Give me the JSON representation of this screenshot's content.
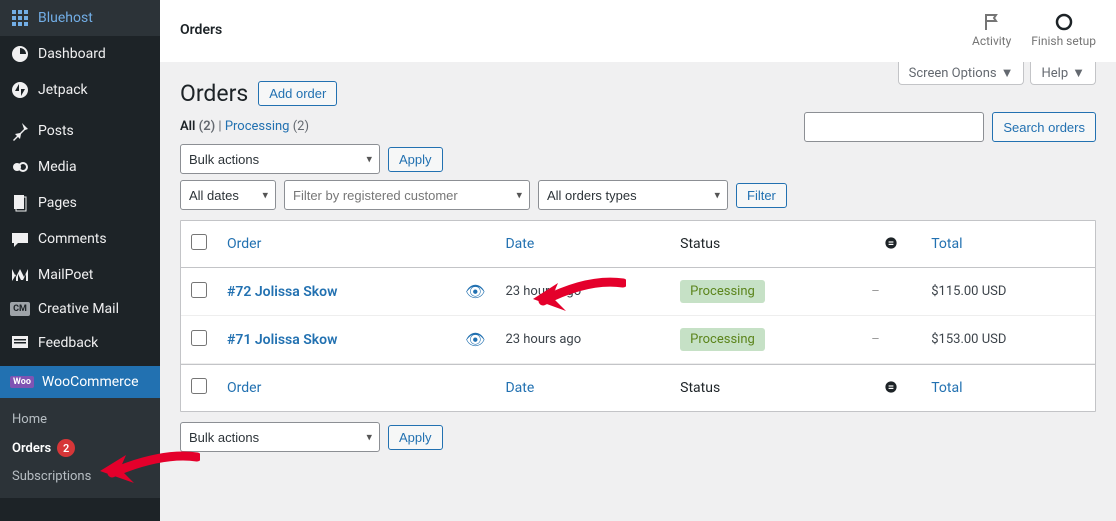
{
  "sidebar": {
    "items": [
      {
        "label": "Bluehost"
      },
      {
        "label": "Dashboard"
      },
      {
        "label": "Jetpack"
      },
      {
        "label": "Posts"
      },
      {
        "label": "Media"
      },
      {
        "label": "Pages"
      },
      {
        "label": "Comments"
      },
      {
        "label": "MailPoet"
      },
      {
        "label": "Creative Mail"
      },
      {
        "label": "Feedback"
      },
      {
        "label": "WooCommerce"
      }
    ],
    "submenu": [
      {
        "label": "Home"
      },
      {
        "label": "Orders",
        "badge": "2"
      },
      {
        "label": "Subscriptions"
      }
    ]
  },
  "topbar": {
    "title": "Orders",
    "activity": "Activity",
    "finish": "Finish setup"
  },
  "screen_options": "Screen Options",
  "help": "Help",
  "heading": "Orders",
  "add_order": "Add order",
  "subsub": {
    "all": "All",
    "all_count": "(2)",
    "sep": " | ",
    "processing": "Processing",
    "processing_count": "(2)"
  },
  "search_btn": "Search orders",
  "bulk_actions": "Bulk actions",
  "apply": "Apply",
  "all_dates": "All dates",
  "filter_customer": "Filter by registered customer",
  "all_orders_types": "All orders types",
  "filter": "Filter",
  "cols": {
    "order": "Order",
    "date": "Date",
    "status": "Status",
    "total": "Total"
  },
  "rows": [
    {
      "order": "#72 Jolissa Skow",
      "date": "23 hours ago",
      "status": "Processing",
      "total": "$115.00 USD"
    },
    {
      "order": "#71 Jolissa Skow",
      "date": "23 hours ago",
      "status": "Processing",
      "total": "$153.00 USD"
    }
  ]
}
